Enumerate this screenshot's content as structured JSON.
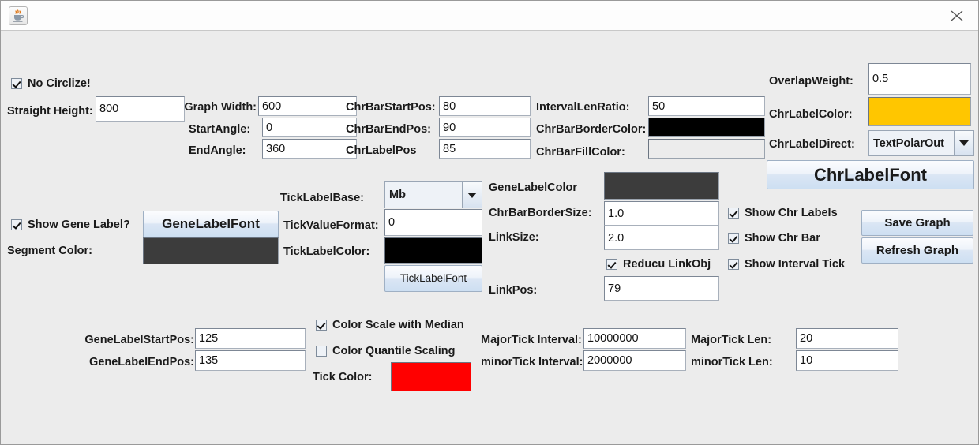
{
  "window": {
    "app_icon": "java-coffee-cup-icon",
    "close_icon": "close-icon"
  },
  "top_section": {
    "no_circlize": {
      "label": "No Circlize!",
      "checked": true
    },
    "straight_height": {
      "label": "Straight Height:",
      "value": "800"
    },
    "graph_width": {
      "label": "Graph Width:",
      "value": "600"
    },
    "start_angle": {
      "label": "StartAngle:",
      "value": "0"
    },
    "end_angle": {
      "label": "EndAngle:",
      "value": "360"
    },
    "chr_bar_start_pos": {
      "label": "ChrBarStartPos:",
      "value": "80"
    },
    "chr_bar_end_pos": {
      "label": "ChrBarEndPos:",
      "value": "90"
    },
    "chr_label_pos": {
      "label": "ChrLabelPos",
      "value": "85"
    },
    "interval_len_ratio": {
      "label": "IntervalLenRatio:",
      "value": "50"
    },
    "chr_bar_border_color": {
      "label": "ChrBarBorderColor:",
      "color": "#000000"
    },
    "chr_bar_fill_color": {
      "label": "ChrBarFillColor:",
      "color": "#ececec"
    },
    "overlap_weight": {
      "label": "OverlapWeight:",
      "value": "0.5"
    },
    "chr_label_color": {
      "label": "ChrLabelColor:",
      "color": "#ffc600"
    },
    "chr_label_direct": {
      "label": "ChrLabelDirect:",
      "value": "TextPolarOut"
    },
    "chr_label_font_button": "ChrLabelFont"
  },
  "middle_section": {
    "show_gene_label": {
      "label": "Show Gene Label?",
      "checked": true
    },
    "gene_label_font_button": "GeneLabelFont",
    "segment_color": {
      "label": "Segment Color:",
      "color": "#3c3c3c"
    },
    "tick_label_base": {
      "label": "TickLabelBase:",
      "value": "Mb"
    },
    "tick_value_format": {
      "label": "TickValueFormat:",
      "value": "0"
    },
    "tick_label_color": {
      "label": "TickLabelColor:",
      "color": "#000000"
    },
    "tick_label_font_button": "TickLabelFont",
    "gene_label_color": {
      "label": "GeneLabelColor",
      "color": "#3c3c3c"
    },
    "chr_bar_border_size": {
      "label": "ChrBarBorderSize:",
      "value": "1.0"
    },
    "link_size": {
      "label": "LinkSize:",
      "value": "2.0"
    },
    "link_pos": {
      "label": "LinkPos:",
      "value": "79"
    },
    "reducu_link_obj": {
      "label": "Reducu LinkObj",
      "checked": true
    },
    "show_chr_labels": {
      "label": "Show Chr Labels",
      "checked": true
    },
    "show_chr_bar": {
      "label": "Show Chr Bar",
      "checked": true
    },
    "show_interval_tick": {
      "label": "Show Interval Tick",
      "checked": true
    },
    "save_graph_button": "Save Graph",
    "refresh_graph_button": "Refresh Graph"
  },
  "bottom_section": {
    "gene_label_start_pos": {
      "label": "GeneLabelStartPos:",
      "value": "125"
    },
    "gene_label_end_pos": {
      "label": "GeneLabelEndPos:",
      "value": "135"
    },
    "color_scale_with_median": {
      "label": "Color Scale with Median",
      "checked": true
    },
    "color_quantile_scaling": {
      "label": "Color Quantile Scaling",
      "checked": false
    },
    "tick_color": {
      "label": "Tick Color:",
      "color": "#ff0000"
    },
    "major_tick_interval": {
      "label": "MajorTick Interval:",
      "value": "10000000"
    },
    "minor_tick_interval": {
      "label": "minorTick Interval:",
      "value": "2000000"
    },
    "major_tick_len": {
      "label": "MajorTick Len:",
      "value": "20"
    },
    "minor_tick_len": {
      "label": "minorTick Len:",
      "value": "10"
    }
  }
}
